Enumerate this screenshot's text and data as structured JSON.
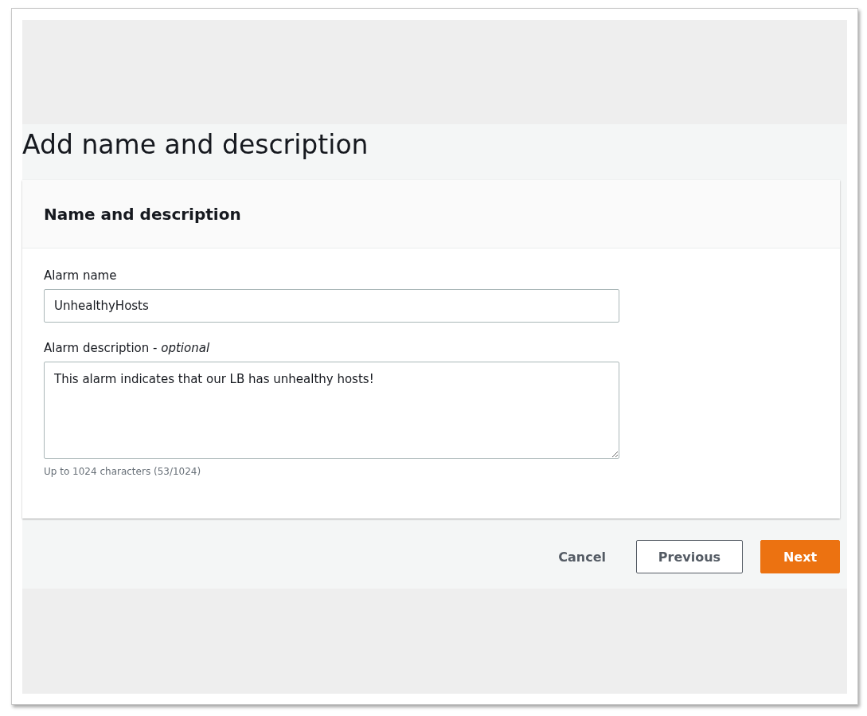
{
  "page": {
    "title": "Add name and description"
  },
  "panel": {
    "title": "Name and description",
    "fields": [
      {
        "kind": "input",
        "label": "Alarm name",
        "value": "UnhealthyHosts"
      },
      {
        "kind": "textarea",
        "label": "Alarm description - *optional*",
        "value": "This alarm indicates that our LB has unhealthy hosts!",
        "hint": "Up to 1024 characters (53/1024)"
      }
    ]
  },
  "buttons": [
    {
      "kind": "link",
      "label": "Cancel"
    },
    {
      "kind": "normal",
      "label": "Previous"
    },
    {
      "kind": "primary",
      "label": "Next"
    }
  ]
}
